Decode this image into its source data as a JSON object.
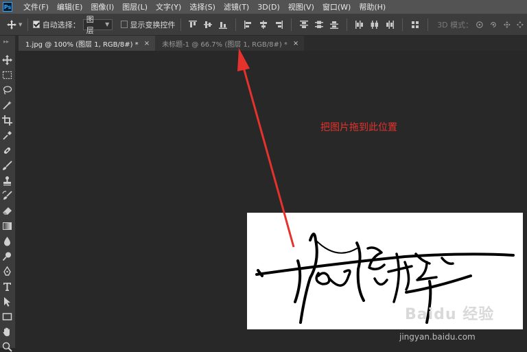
{
  "menubar": {
    "logo": "Ps",
    "items": [
      "文件(F)",
      "编辑(E)",
      "图像(I)",
      "图层(L)",
      "文字(Y)",
      "选择(S)",
      "滤镜(T)",
      "3D(D)",
      "视图(V)",
      "窗口(W)",
      "帮助(H)"
    ]
  },
  "options": {
    "auto_select_label": "自动选择：",
    "auto_select_checked": true,
    "layer_select_value": "图层",
    "show_transform_label": "显示变换控件",
    "show_transform_checked": false,
    "mode3d_label": "3D 模式："
  },
  "tabs": [
    {
      "label": "1.jpg @ 100% (图层 1, RGB/8#) *",
      "close": "×",
      "active": true
    },
    {
      "label": "未标题-1 @ 66.7% (图层 1, RGB/8#) *",
      "close": "×",
      "active": false
    }
  ],
  "tools": [
    "move-tool-icon",
    "marquee-tool-icon",
    "lasso-tool-icon",
    "magic-wand-tool-icon",
    "crop-tool-icon",
    "eyedropper-tool-icon",
    "healing-brush-tool-icon",
    "brush-tool-icon",
    "clone-stamp-tool-icon",
    "history-brush-tool-icon",
    "eraser-tool-icon",
    "gradient-tool-icon",
    "blur-tool-icon",
    "dodge-tool-icon",
    "pen-tool-icon",
    "type-tool-icon",
    "path-selection-tool-icon",
    "rectangle-tool-icon",
    "hand-tool-icon",
    "zoom-tool-icon"
  ],
  "annotation": {
    "text": "把图片拖到此位置",
    "color": "#e6322c"
  },
  "watermark": {
    "logo": "Baidu 经验",
    "url": "jingyan.baidu.com"
  },
  "colors": {
    "menubar_bg": "#535353",
    "panel_bg": "#3c3c3c",
    "canvas_bg": "#282828",
    "arrow": "#e6322c"
  }
}
